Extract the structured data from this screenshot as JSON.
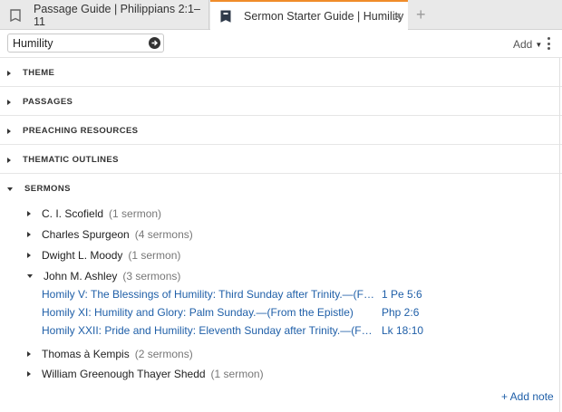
{
  "tabs": [
    {
      "label": "Passage Guide | Philippians 2:1–11",
      "active": false
    },
    {
      "label": "Sermon Starter Guide | Humility",
      "active": true
    }
  ],
  "tab_close_glyph": "✕",
  "tab_add_glyph": "+",
  "search": {
    "value": "Humility",
    "placeholder": ""
  },
  "toolbar": {
    "add_label": "Add"
  },
  "sections": [
    {
      "label": "THEME",
      "expanded": false
    },
    {
      "label": "PASSAGES",
      "expanded": false
    },
    {
      "label": "PREACHING RESOURCES",
      "expanded": false
    },
    {
      "label": "THEMATIC OUTLINES",
      "expanded": false
    },
    {
      "label": "SERMONS",
      "expanded": true
    }
  ],
  "authors": [
    {
      "name": "C. I. Scofield",
      "count": "(1 sermon)",
      "expanded": false
    },
    {
      "name": "Charles Spurgeon",
      "count": "(4 sermons)",
      "expanded": false
    },
    {
      "name": "Dwight L. Moody",
      "count": "(1 sermon)",
      "expanded": false
    },
    {
      "name": "John M. Ashley",
      "count": "(3 sermons)",
      "expanded": true
    },
    {
      "name": "Thomas à Kempis",
      "count": "(2 sermons)",
      "expanded": false
    },
    {
      "name": "William Greenough Thayer Shedd",
      "count": "(1 sermon)",
      "expanded": false
    }
  ],
  "sermons": [
    {
      "title": "Homily V: The Blessings of Humility: Third Sunday after Trinity.—(From the Epistle)",
      "ref": "1 Pe 5:6"
    },
    {
      "title": "Homily XI: Humility and Glory: Palm Sunday.—(From the Epistle)",
      "ref": "Php 2:6"
    },
    {
      "title": "Homily XXII: Pride and Humility: Eleventh Sunday after Trinity.—(From the Gospel)",
      "ref": "Lk 18:10"
    }
  ],
  "add_note_label": "+ Add note",
  "colors": {
    "accent": "#f08c2a",
    "link": "#1f5fa8"
  }
}
